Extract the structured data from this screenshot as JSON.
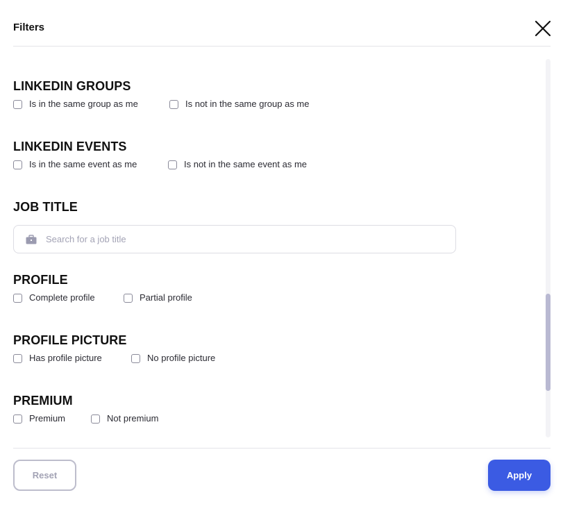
{
  "header": {
    "title": "Filters",
    "close_icon": "close-icon"
  },
  "sections": {
    "linkedin_groups": {
      "title": "LINKEDIN GROUPS",
      "options": [
        "Is in the same group as me",
        "Is not in the same group as me"
      ]
    },
    "linkedin_events": {
      "title": "LINKEDIN EVENTS",
      "options": [
        "Is in the same event as me",
        "Is not in the same event as me"
      ]
    },
    "job_title": {
      "title": "JOB TITLE",
      "search_placeholder": "Search for a job title",
      "search_value": "",
      "icon": "briefcase-icon"
    },
    "profile": {
      "title": "PROFILE",
      "options": [
        "Complete profile",
        "Partial profile"
      ]
    },
    "profile_picture": {
      "title": "PROFILE PICTURE",
      "options": [
        "Has profile picture",
        "No profile picture"
      ]
    },
    "premium": {
      "title": "PREMIUM",
      "options": [
        "Premium",
        "Not premium"
      ]
    }
  },
  "footer": {
    "reset_label": "Reset",
    "apply_label": "Apply"
  },
  "colors": {
    "accent": "#3b5be3",
    "scrollbar_thumb": "#b9b9d2",
    "muted_text": "#a3a3b5"
  }
}
